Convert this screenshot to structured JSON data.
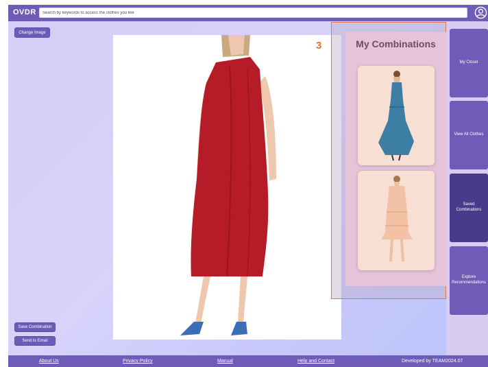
{
  "header": {
    "logo": "OVDR",
    "search_placeholder": "Search by keywords to access the clothes you like"
  },
  "buttons": {
    "change_image": "Change Image",
    "save_combination": "Save Combination",
    "send_to_email": "Send to Email"
  },
  "annotation_number": "3",
  "combinations": {
    "title": "My Combinations",
    "items": [
      "blue-gown-thumbnail",
      "peach-dress-thumbnail"
    ]
  },
  "nav": {
    "items": [
      {
        "label": "My Closet",
        "active": false
      },
      {
        "label": "View All Clothes",
        "active": false
      },
      {
        "label": "Saved Combinations",
        "active": true
      },
      {
        "label": "Explore Recommendations",
        "active": false
      }
    ]
  },
  "footer": {
    "about": "About Us",
    "privacy": "Privacy Policy",
    "manual": "Manual",
    "help": "Help and Contact",
    "credit": "Developed by TEAM2024.07"
  },
  "colors": {
    "primary": "#6e5cb8",
    "active_nav": "#4a3a8c",
    "annotation": "#e57745",
    "dress": "#b51c27",
    "shoes": "#3a6fb8"
  }
}
